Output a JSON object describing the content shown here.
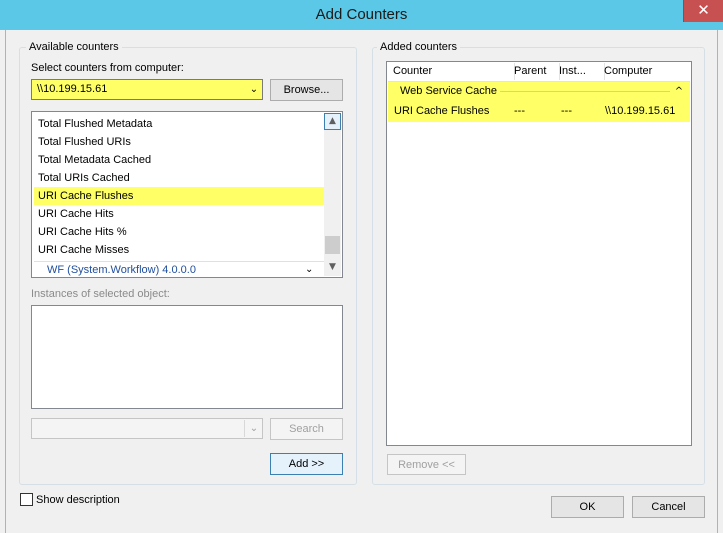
{
  "window": {
    "title": "Add Counters",
    "close_glyph": "✕"
  },
  "available": {
    "group_label": "Available counters",
    "select_label": "Select counters from computer:",
    "computer_value": "\\\\10.199.15.61",
    "browse_label": "Browse...",
    "counters": [
      {
        "label": "Total Flushed Metadata",
        "selected": false
      },
      {
        "label": "Total Flushed URIs",
        "selected": false
      },
      {
        "label": "Total Metadata Cached",
        "selected": false
      },
      {
        "label": "Total URIs Cached",
        "selected": false
      },
      {
        "label": "URI Cache Flushes",
        "selected": true
      },
      {
        "label": "URI Cache Hits",
        "selected": false
      },
      {
        "label": "URI Cache Hits %",
        "selected": false
      },
      {
        "label": "URI Cache Misses",
        "selected": false
      }
    ],
    "next_object": "WF (System.Workflow) 4.0.0.0",
    "instances_label": "Instances of selected object:",
    "search_value": "",
    "search_label": "Search",
    "add_label": "Add >>"
  },
  "added": {
    "group_label": "Added counters",
    "columns": [
      "Counter",
      "Parent",
      "Inst...",
      "Computer"
    ],
    "group_row": "Web Service Cache",
    "collapse_glyph": "^",
    "rows": [
      {
        "counter": "URI Cache Flushes",
        "parent": "---",
        "instance": "---",
        "computer": "\\\\10.199.15.61"
      }
    ],
    "remove_label": "Remove <<"
  },
  "footer": {
    "show_description_label": "Show description",
    "show_description_checked": false,
    "ok_label": "OK",
    "cancel_label": "Cancel"
  },
  "colors": {
    "title_bar": "#5bc8e8",
    "close_button": "#c75050",
    "highlight": "#ffff66"
  }
}
